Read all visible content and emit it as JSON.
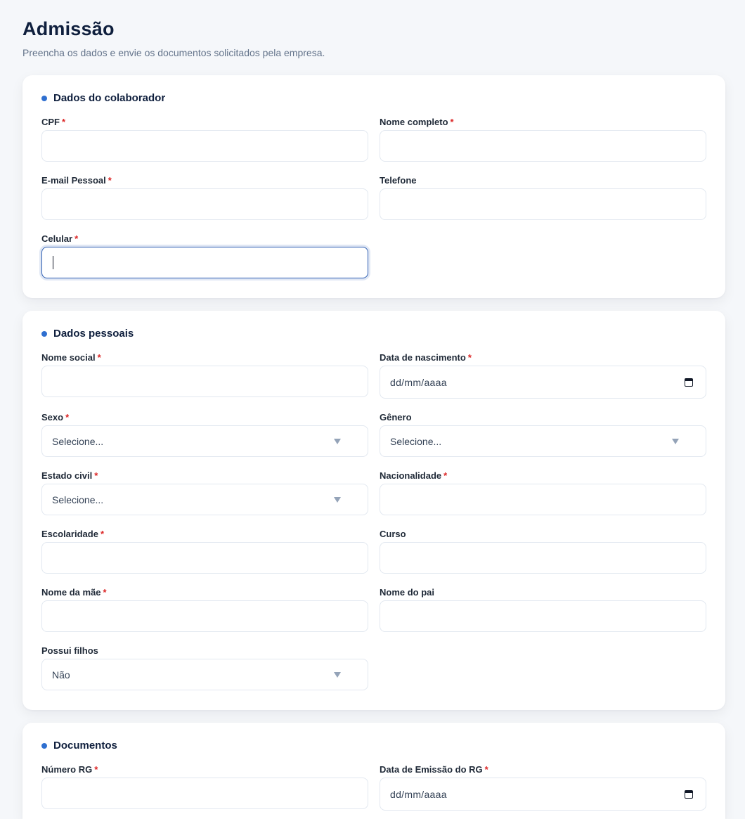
{
  "header": {
    "title": "Admissão",
    "subtitle": "Preencha os dados e envie os documentos solicitados pela empresa."
  },
  "required_mark": "*",
  "sections": {
    "colaborador": {
      "title": "Dados do colaborador",
      "fields": {
        "cpf": {
          "label": "CPF",
          "value": ""
        },
        "nome_completo": {
          "label": "Nome completo",
          "value": ""
        },
        "email_pessoal": {
          "label": "E-mail Pessoal",
          "value": ""
        },
        "telefone": {
          "label": "Telefone",
          "value": ""
        },
        "celular": {
          "label": "Celular",
          "value": ""
        }
      }
    },
    "pessoais": {
      "title": "Dados pessoais",
      "fields": {
        "nome_social": {
          "label": "Nome social",
          "value": ""
        },
        "data_nascimento": {
          "label": "Data de nascimento",
          "placeholder": "dd/mm/aaaa"
        },
        "sexo": {
          "label": "Sexo",
          "selected": "Selecione..."
        },
        "genero": {
          "label": "Gênero",
          "selected": "Selecione..."
        },
        "estado_civil": {
          "label": "Estado civil",
          "selected": "Selecione..."
        },
        "nacionalidade": {
          "label": "Nacionalidade",
          "value": ""
        },
        "escolaridade": {
          "label": "Escolaridade",
          "value": ""
        },
        "curso": {
          "label": "Curso",
          "value": ""
        },
        "nome_mae": {
          "label": "Nome da mãe",
          "value": ""
        },
        "nome_pai": {
          "label": "Nome do pai",
          "value": ""
        },
        "possui_filhos": {
          "label": "Possui filhos",
          "selected": "Não"
        }
      }
    },
    "documentos": {
      "title": "Documentos",
      "fields": {
        "numero_rg": {
          "label": "Número RG",
          "value": ""
        },
        "data_emissao_rg": {
          "label": "Data de Emissão do RG",
          "placeholder": "dd/mm/aaaa"
        }
      }
    }
  },
  "colors": {
    "accent": "#2f6fd0",
    "required": "#dc2626",
    "title": "#0f1f3d",
    "focus_border": "#2f5fb3"
  }
}
